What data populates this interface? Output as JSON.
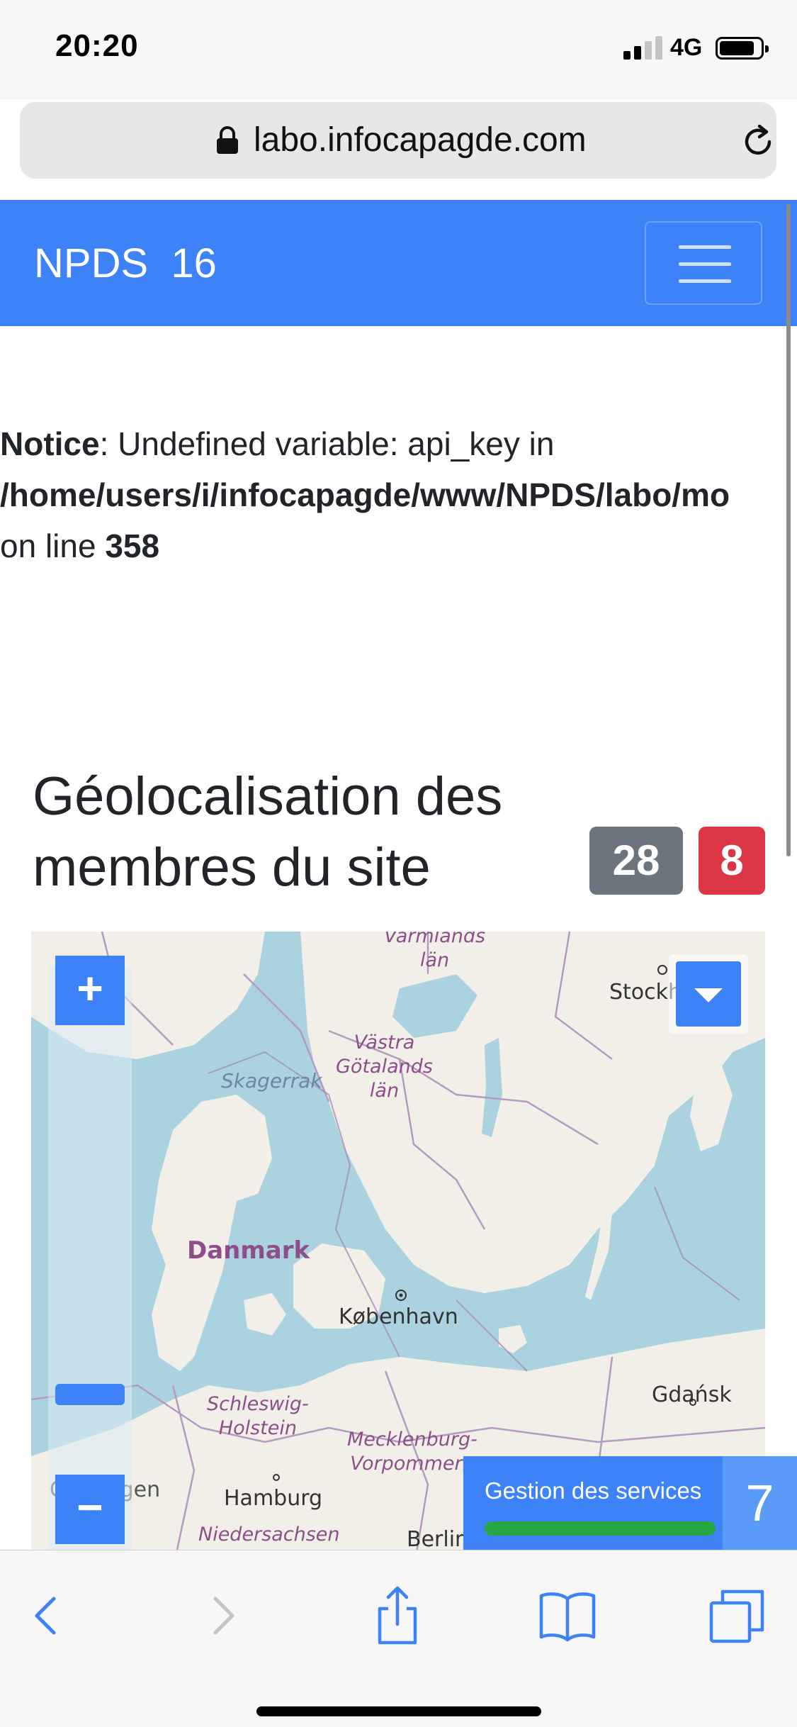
{
  "status": {
    "time": "20:20",
    "network": "4G"
  },
  "browser": {
    "url": "labo.infocapagde.com"
  },
  "navbar": {
    "brand": "NPDS  16"
  },
  "notice": {
    "label": "Notice",
    "message": ": Undefined variable: api_key in",
    "path": "/home/users/i/infocapagde/www/NPDS/labo/mo",
    "line_prefix": "on line ",
    "line_number": "358"
  },
  "section": {
    "title_line1": "Géolocalisation des",
    "title_line2": "membres du site",
    "badge_members": "28",
    "badge_other": "8"
  },
  "map": {
    "labels": {
      "varmland": "Värmlands",
      "varmland_lan": "län",
      "stockholm": "Stockholm",
      "skagerrak": "Skagerrak",
      "vastra1": "Västra",
      "vastra2": "Götalands",
      "vastra3": "län",
      "danmark": "Danmark",
      "kobenhavn": "København",
      "gdansk": "Gdańsk",
      "schleswig1": "Schleswig-",
      "schleswig2": "Holstein",
      "mecklenburg1": "Mecklenburg-",
      "mecklenburg2": "Vorpommern",
      "groningen": "Groningen",
      "hamburg": "Hamburg",
      "niedersachsen": "Niedersachsen",
      "berlin": "Berlin"
    },
    "zoom_in": "+",
    "zoom_out": "−"
  },
  "services": {
    "label": "Gestion des services",
    "count": "7"
  },
  "colors": {
    "primary": "#3d83f7",
    "gray_badge": "#6c757d",
    "red_badge": "#dc3545",
    "progress": "#28a745",
    "water": "#aad3df",
    "land": "#f2efe9"
  }
}
